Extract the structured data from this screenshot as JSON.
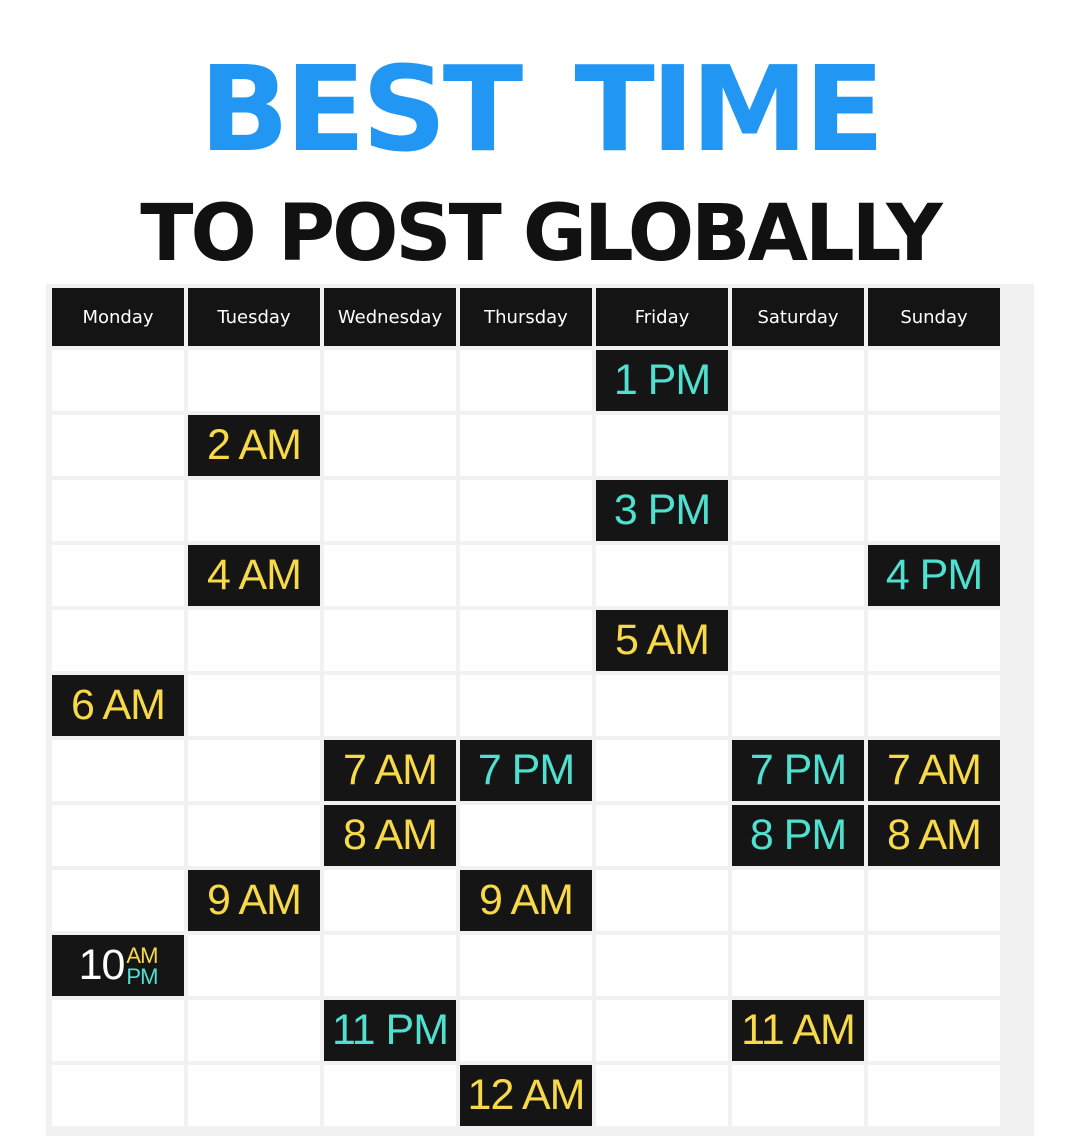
{
  "title": {
    "line1": "BEST  TIME",
    "line2": "TO POST GLOBALLY"
  },
  "days": [
    "Monday",
    "Tuesday",
    "Wednesday",
    "Thursday",
    "Friday",
    "Saturday",
    "Sunday"
  ],
  "colors": {
    "title_blue": "#2196f3",
    "am_text": "#f8d94a",
    "pm_text": "#4fe0cf",
    "cell_dark": "#151515"
  },
  "slots": [
    {
      "day": "Friday",
      "label": "1 PM",
      "period": "PM"
    },
    {
      "day": "Tuesday",
      "label": "2 AM",
      "period": "AM"
    },
    {
      "day": "Friday",
      "label": "3 PM",
      "period": "PM"
    },
    {
      "day": "Tuesday",
      "label": "4 AM",
      "period": "AM"
    },
    {
      "day": "Sunday",
      "label": "4 PM",
      "period": "PM"
    },
    {
      "day": "Friday",
      "label": "5 AM",
      "period": "AM"
    },
    {
      "day": "Monday",
      "label": "6 AM",
      "period": "AM"
    },
    {
      "day": "Wednesday",
      "label": "7 AM",
      "period": "AM"
    },
    {
      "day": "Thursday",
      "label": "7 PM",
      "period": "PM"
    },
    {
      "day": "Saturday",
      "label": "7 PM",
      "period": "PM"
    },
    {
      "day": "Sunday",
      "label": "7 AM",
      "period": "AM"
    },
    {
      "day": "Wednesday",
      "label": "8 AM",
      "period": "AM"
    },
    {
      "day": "Saturday",
      "label": "8 PM",
      "period": "PM"
    },
    {
      "day": "Sunday",
      "label": "8 AM",
      "period": "AM"
    },
    {
      "day": "Tuesday",
      "label": "9 AM",
      "period": "AM"
    },
    {
      "day": "Thursday",
      "label": "9 AM",
      "period": "AM"
    },
    {
      "day": "Monday",
      "number": "10",
      "am": "AM",
      "pm": "PM"
    },
    {
      "day": "Wednesday",
      "label": "11 PM",
      "period": "PM"
    },
    {
      "day": "Saturday",
      "label": "11 AM",
      "period": "AM"
    },
    {
      "day": "Thursday",
      "label": "12 AM",
      "period": "AM"
    }
  ]
}
